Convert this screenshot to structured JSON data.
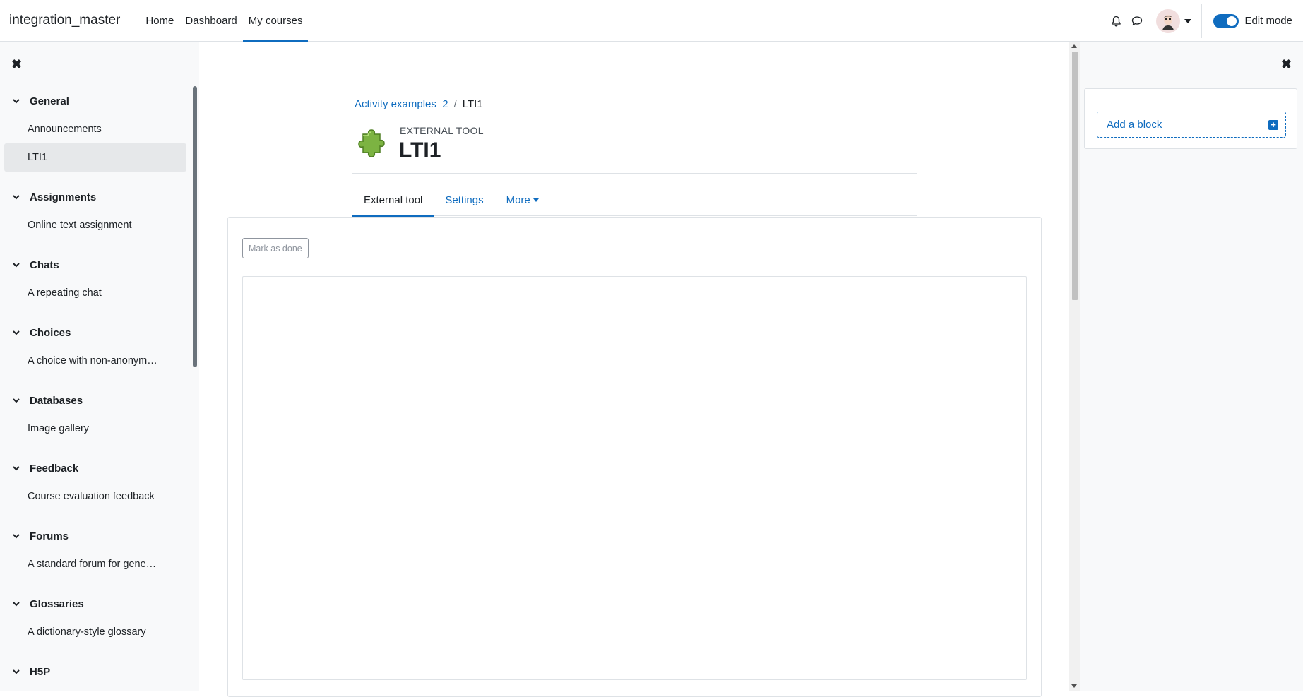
{
  "navbar": {
    "site_name": "integration_master",
    "links": [
      "Home",
      "Dashboard",
      "My courses"
    ],
    "active_link": "My courses",
    "edit_mode_label": "Edit mode",
    "edit_mode_on": true
  },
  "course_index": {
    "sections": [
      {
        "title": "General",
        "items": [
          "Announcements",
          "LTI1"
        ]
      },
      {
        "title": "Assignments",
        "items": [
          "Online text assignment"
        ]
      },
      {
        "title": "Chats",
        "items": [
          "A repeating chat"
        ]
      },
      {
        "title": "Choices",
        "items": [
          "A choice with non-anonym…"
        ]
      },
      {
        "title": "Databases",
        "items": [
          "Image gallery"
        ]
      },
      {
        "title": "Feedback",
        "items": [
          "Course evaluation feedback"
        ]
      },
      {
        "title": "Forums",
        "items": [
          "A standard forum for gene…"
        ]
      },
      {
        "title": "Glossaries",
        "items": [
          "A dictionary-style glossary"
        ]
      },
      {
        "title": "H5P",
        "items": []
      }
    ],
    "active_item": "LTI1"
  },
  "breadcrumb": {
    "course": "Activity examples_2",
    "separator": "/",
    "current": "LTI1"
  },
  "header": {
    "activity_type": "EXTERNAL TOOL",
    "title": "LTI1"
  },
  "tabs": {
    "external_tool": "External tool",
    "settings": "Settings",
    "more": "More"
  },
  "content": {
    "mark_as_done": "Mark as done"
  },
  "block_drawer": {
    "add_block": "Add a block"
  },
  "colors": {
    "accent": "#0f6cbf",
    "drawer_bg": "#f8f9fa",
    "active_item_bg": "#e6e8ea"
  }
}
